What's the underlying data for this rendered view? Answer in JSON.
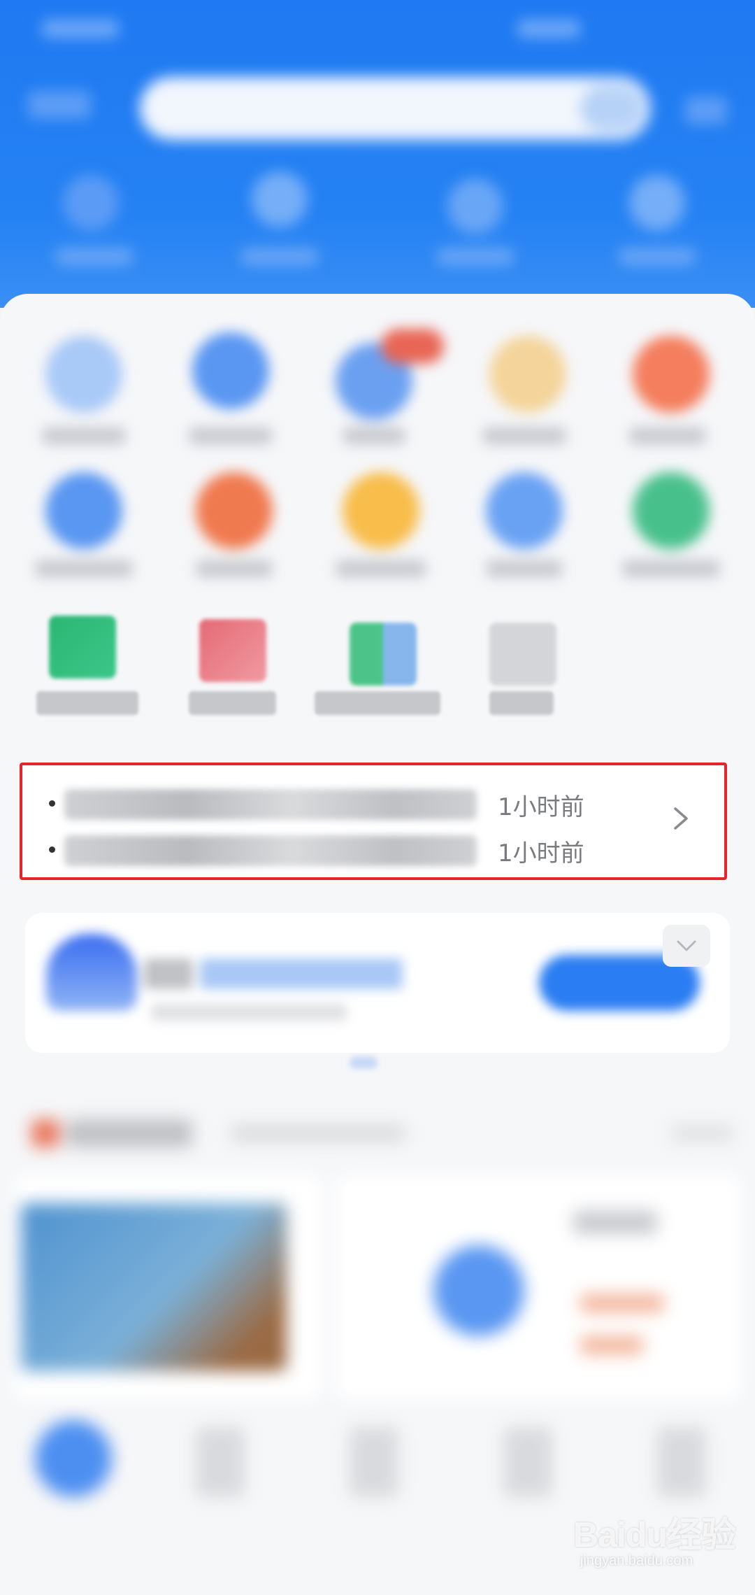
{
  "news": {
    "items": [
      {
        "text": "",
        "time": "1小时前"
      },
      {
        "text": "",
        "time": "1小时前"
      }
    ]
  },
  "watermark": {
    "brand": "Baidu经验",
    "url": "jingyan.baidu.com"
  },
  "colors": {
    "header_blue": "#1f79f2",
    "highlight_red": "#e8242b",
    "time_gray": "#7a7b80"
  },
  "icons": {
    "news_arrow": "chevron-right-icon",
    "collapse": "chevron-down-icon"
  }
}
